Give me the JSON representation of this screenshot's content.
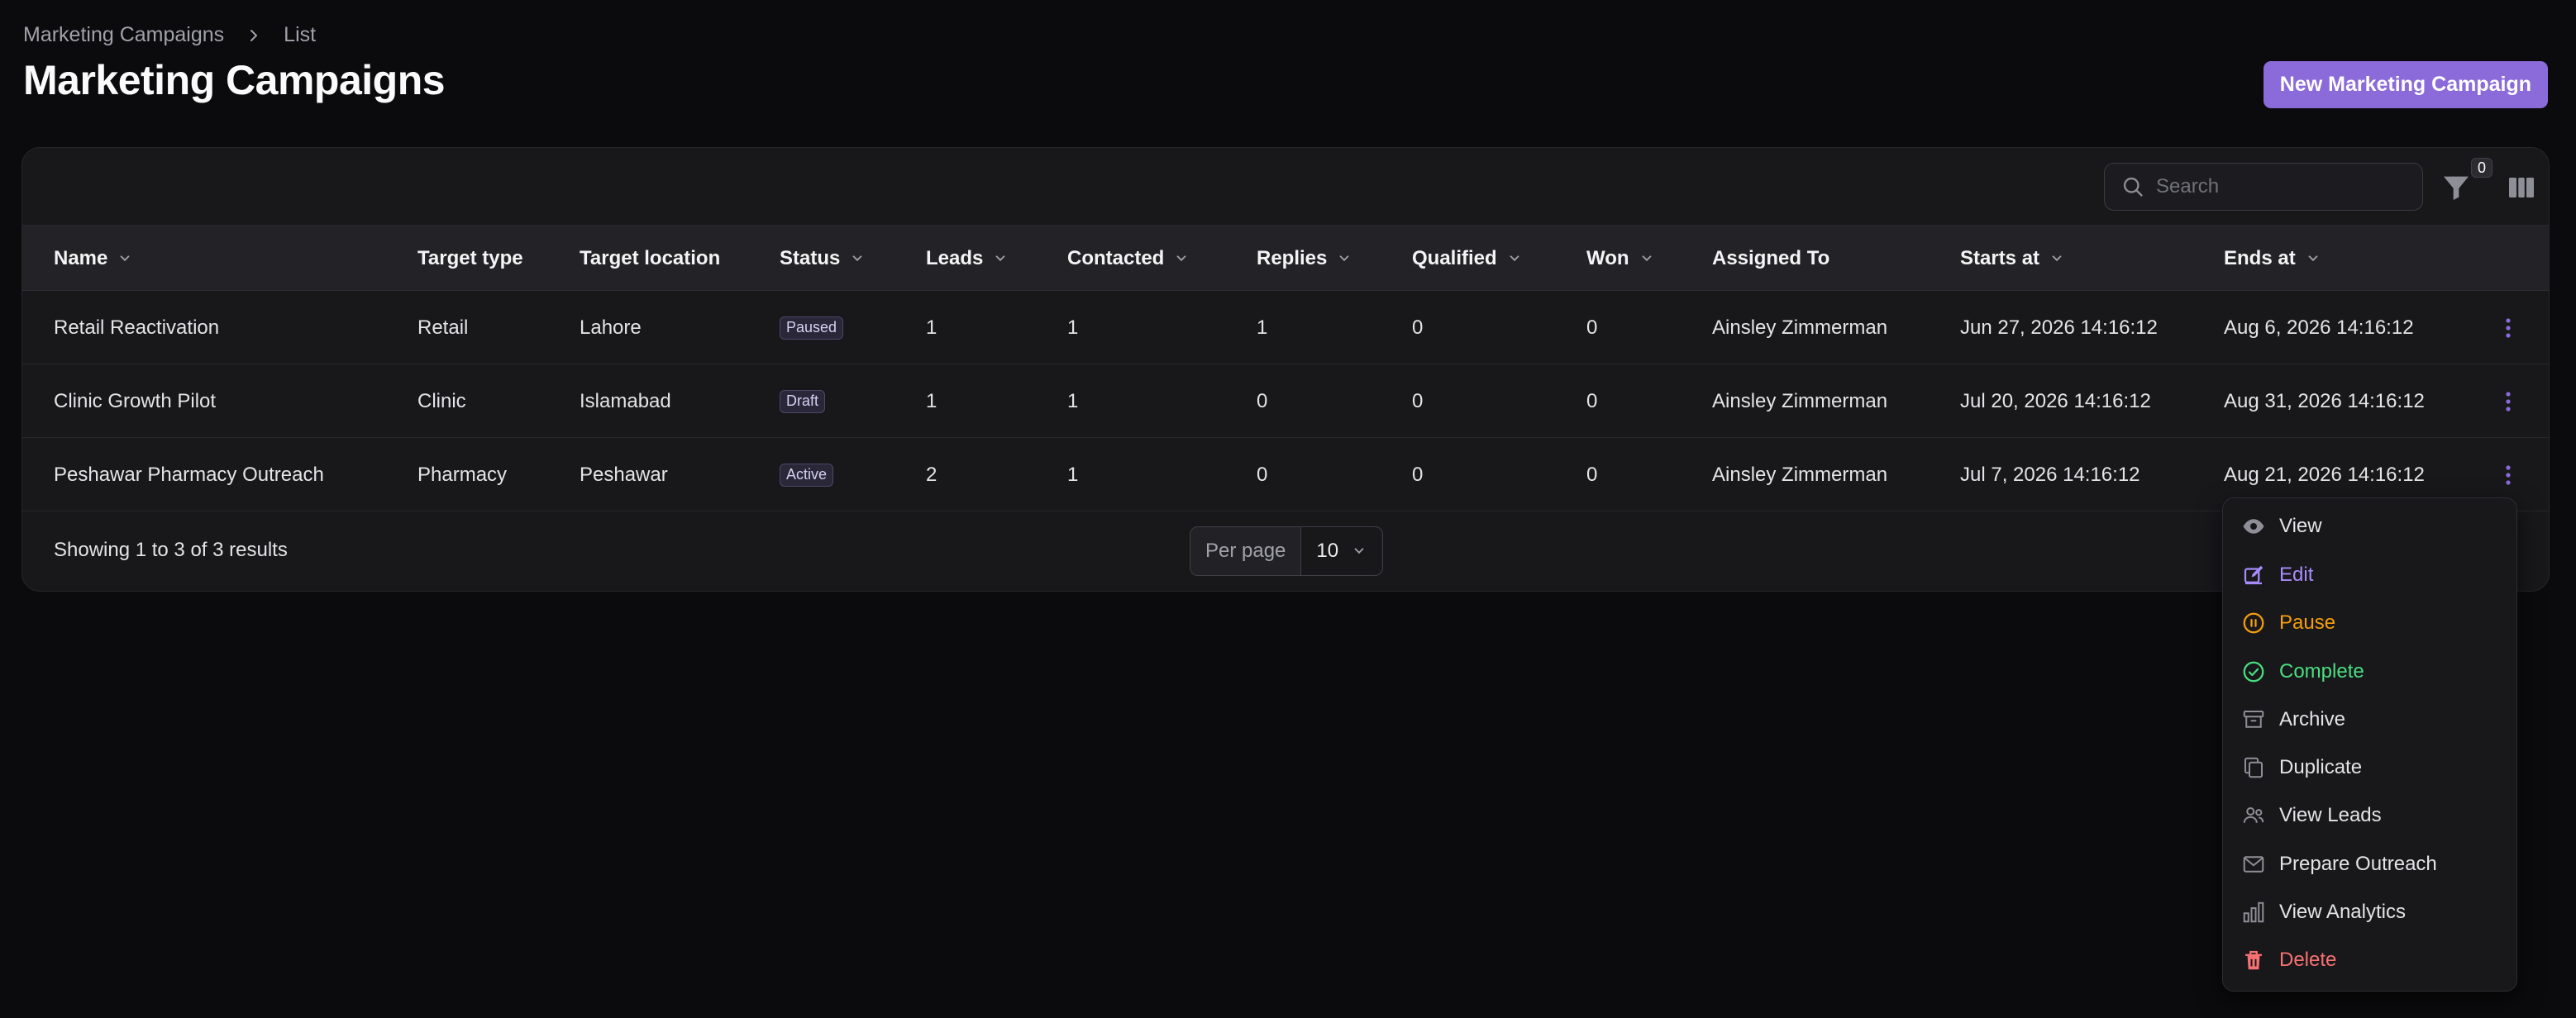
{
  "breadcrumb": {
    "parent": "Marketing Campaigns",
    "current": "List"
  },
  "page": {
    "title": "Marketing Campaigns",
    "new_button": "New Marketing Campaign"
  },
  "toolbar": {
    "search_placeholder": "Search",
    "filter_count": "0"
  },
  "table": {
    "columns": [
      "Name",
      "Target type",
      "Target location",
      "Status",
      "Leads",
      "Contacted",
      "Replies",
      "Qualified",
      "Won",
      "Assigned To",
      "Starts at",
      "Ends at"
    ],
    "rows": [
      {
        "name": "Retail Reactivation",
        "target_type": "Retail",
        "target_location": "Lahore",
        "status": "Paused",
        "leads": "1",
        "contacted": "1",
        "replies": "1",
        "qualified": "0",
        "won": "0",
        "assigned_to": "Ainsley Zimmerman",
        "starts_at": "Jun 27, 2026 14:16:12",
        "ends_at": "Aug 6, 2026 14:16:12"
      },
      {
        "name": "Clinic Growth Pilot",
        "target_type": "Clinic",
        "target_location": "Islamabad",
        "status": "Draft",
        "leads": "1",
        "contacted": "1",
        "replies": "0",
        "qualified": "0",
        "won": "0",
        "assigned_to": "Ainsley Zimmerman",
        "starts_at": "Jul 20, 2026 14:16:12",
        "ends_at": "Aug 31, 2026 14:16:12"
      },
      {
        "name": "Peshawar Pharmacy Outreach",
        "target_type": "Pharmacy",
        "target_location": "Peshawar",
        "status": "Active",
        "leads": "2",
        "contacted": "1",
        "replies": "0",
        "qualified": "0",
        "won": "0",
        "assigned_to": "Ainsley Zimmerman",
        "starts_at": "Jul 7, 2026 14:16:12",
        "ends_at": "Aug 21, 2026 14:16:12"
      }
    ]
  },
  "footer": {
    "results_text": "Showing 1 to 3 of 3 results",
    "per_page_label": "Per page",
    "per_page_value": "10"
  },
  "action_menu": {
    "items": [
      {
        "label": "View",
        "icon": "eye-icon",
        "color": "#e4e4e7"
      },
      {
        "label": "Edit",
        "icon": "edit-icon",
        "color": "#a78bfa"
      },
      {
        "label": "Pause",
        "icon": "pause-circle-icon",
        "color": "#f59e0b"
      },
      {
        "label": "Complete",
        "icon": "check-circle-icon",
        "color": "#4ade80"
      },
      {
        "label": "Archive",
        "icon": "archive-icon",
        "color": "#e4e4e7"
      },
      {
        "label": "Duplicate",
        "icon": "duplicate-icon",
        "color": "#e4e4e7"
      },
      {
        "label": "View Leads",
        "icon": "users-icon",
        "color": "#e4e4e7"
      },
      {
        "label": "Prepare Outreach",
        "icon": "envelope-icon",
        "color": "#e4e4e7"
      },
      {
        "label": "View Analytics",
        "icon": "bar-chart-icon",
        "color": "#e4e4e7"
      },
      {
        "label": "Delete",
        "icon": "trash-icon",
        "color": "#f87171"
      }
    ]
  },
  "colors": {
    "accent": "#8b6ad9",
    "background": "#0b0b0d",
    "panel": "#18181b",
    "kebab": "#8b6ad9"
  }
}
